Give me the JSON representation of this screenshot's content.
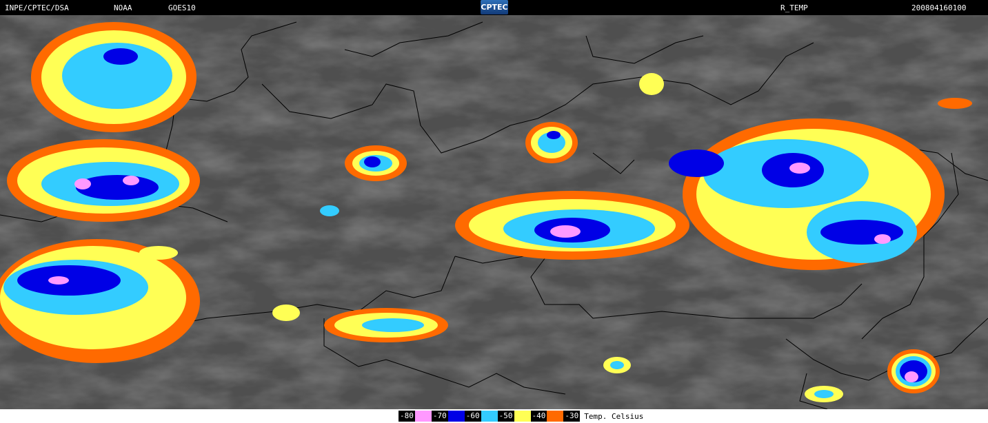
{
  "header": {
    "institution": "INPE/CPTEC/DSA",
    "agency": "NOAA",
    "satellite": "GOES10",
    "logo_text": "CPTEC",
    "product": "R_TEMP",
    "timestamp": "200804160100"
  },
  "legend": {
    "title": "Temp. Celsius",
    "items": [
      {
        "label": "-80",
        "color": "#ff99ff"
      },
      {
        "label": "-70",
        "color": "#0000e6"
      },
      {
        "label": "-60",
        "color": "#33ccff"
      },
      {
        "label": "-50",
        "color": "#ffff55"
      },
      {
        "label": "-40",
        "color": "#ff6a00"
      },
      {
        "label": "-30",
        "color": "#ff6a00"
      }
    ]
  }
}
